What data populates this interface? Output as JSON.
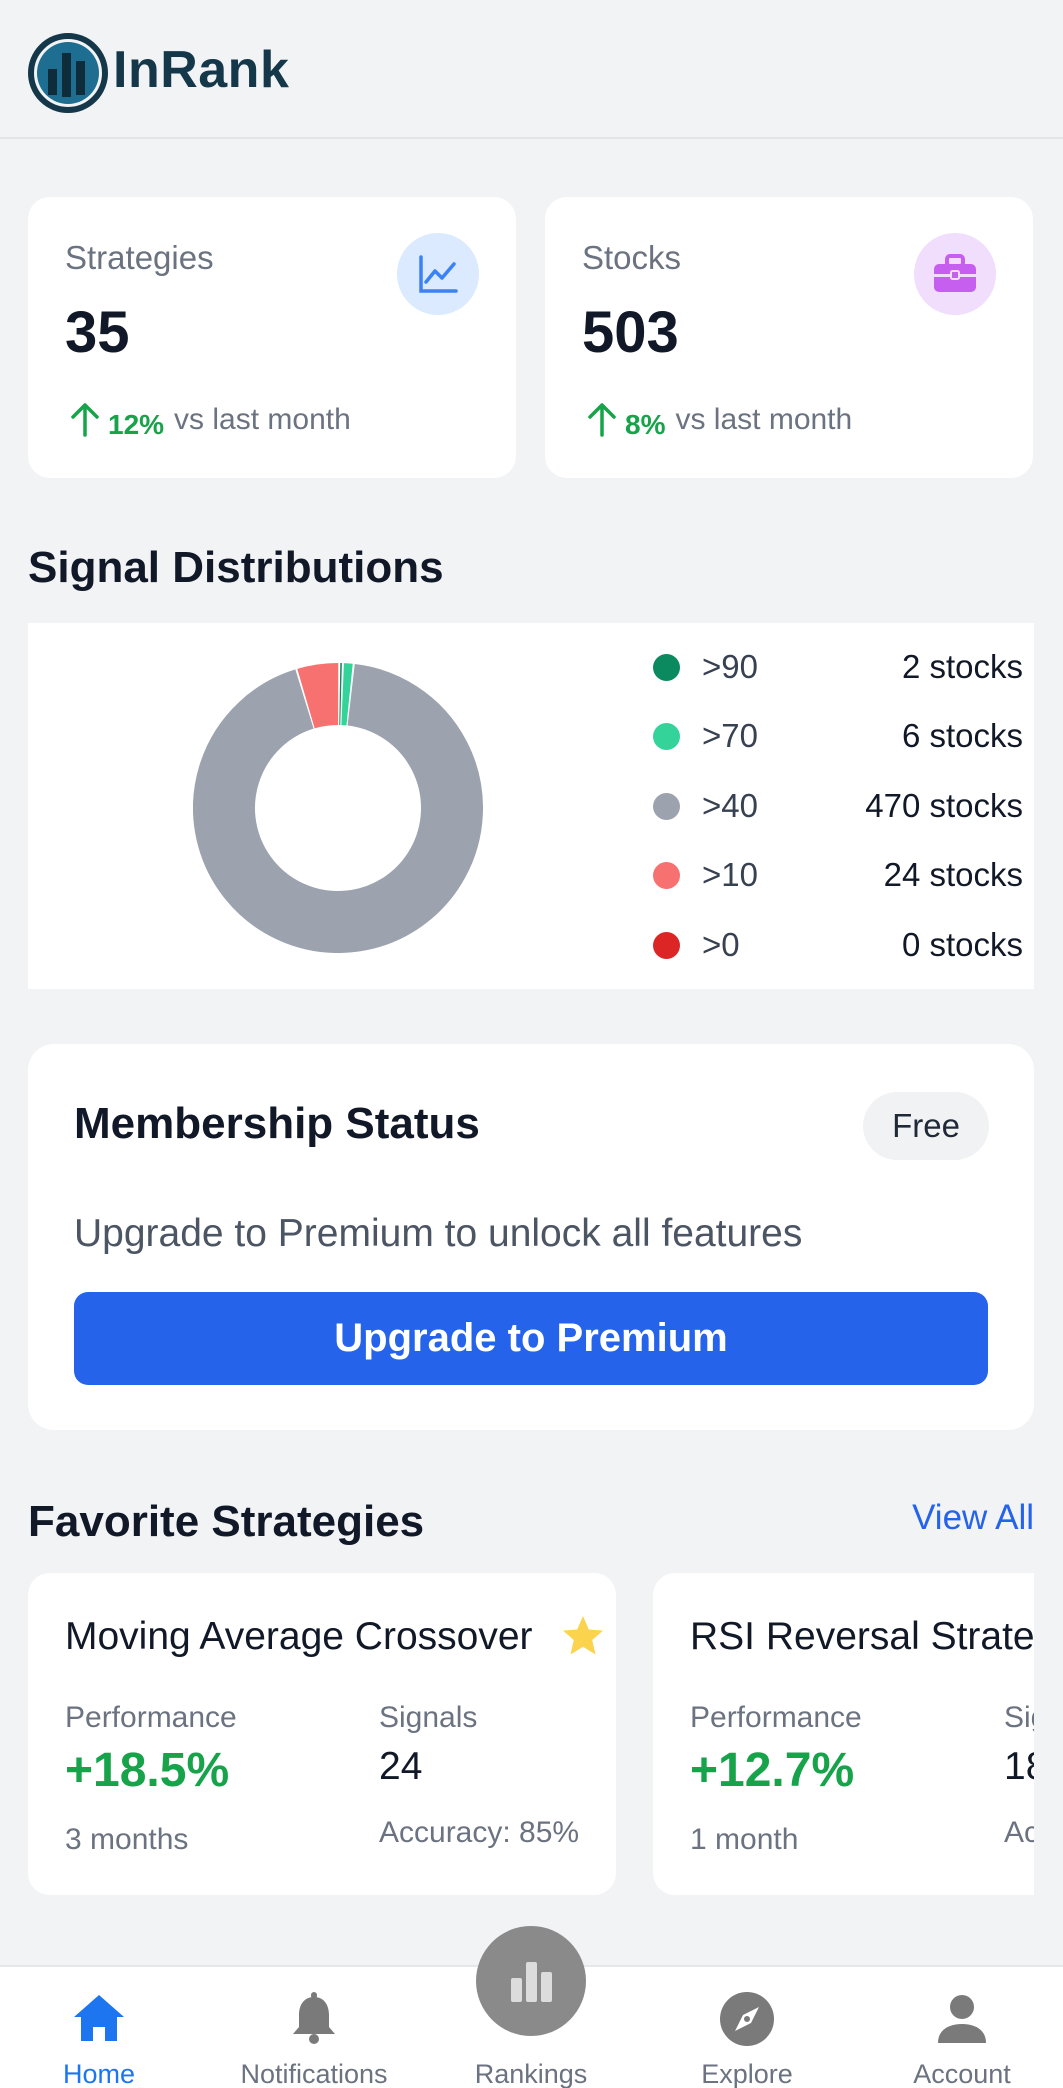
{
  "app": {
    "name": "InRank"
  },
  "stats": [
    {
      "label": "Strategies",
      "value": "35",
      "change": "12%",
      "change_text": "vs last month",
      "icon": "chart-line-icon"
    },
    {
      "label": "Stocks",
      "value": "503",
      "change": "8%",
      "change_text": "vs last month",
      "icon": "briefcase-icon"
    }
  ],
  "signal_distribution": {
    "title": "Signal Distributions",
    "legend": [
      {
        "label": ">90",
        "count": "2 stocks",
        "value": 2,
        "color": "#0b8a5f"
      },
      {
        "label": ">70",
        "count": "6 stocks",
        "value": 6,
        "color": "#34d399"
      },
      {
        "label": ">40",
        "count": "470 stocks",
        "value": 470,
        "color": "#9ca3af"
      },
      {
        "label": ">10",
        "count": "24 stocks",
        "value": 24,
        "color": "#f87171"
      },
      {
        "label": ">0",
        "count": "0 stocks",
        "value": 0,
        "color": "#dc2626"
      }
    ]
  },
  "membership": {
    "title": "Membership Status",
    "badge": "Free",
    "text": "Upgrade to Premium to unlock all features",
    "button": "Upgrade to Premium"
  },
  "favorites": {
    "title": "Favorite Strategies",
    "view_all": "View All",
    "items": [
      {
        "name": "Moving Average Crossover",
        "performance_label": "Performance",
        "performance": "+18.5%",
        "period": "3 months",
        "signals_label": "Signals",
        "signals": "24",
        "accuracy": "Accuracy: 85%",
        "starred": true
      },
      {
        "name": "RSI Reversal Strate",
        "performance_label": "Performance",
        "performance": "+12.7%",
        "period": "1 month",
        "signals_label": "Sig",
        "signals": "18",
        "accuracy": "Ac"
      }
    ]
  },
  "nav": {
    "items": [
      {
        "label": "Home",
        "icon": "home-icon",
        "active": true
      },
      {
        "label": "Notifications",
        "icon": "bell-icon"
      },
      {
        "label": "Rankings",
        "icon": "bar-chart-icon"
      },
      {
        "label": "Explore",
        "icon": "compass-icon"
      },
      {
        "label": "Account",
        "icon": "user-icon"
      }
    ]
  },
  "colors": {
    "accent": "#2563eb",
    "positive": "#16a34a",
    "nav_active": "#1d76f0"
  }
}
